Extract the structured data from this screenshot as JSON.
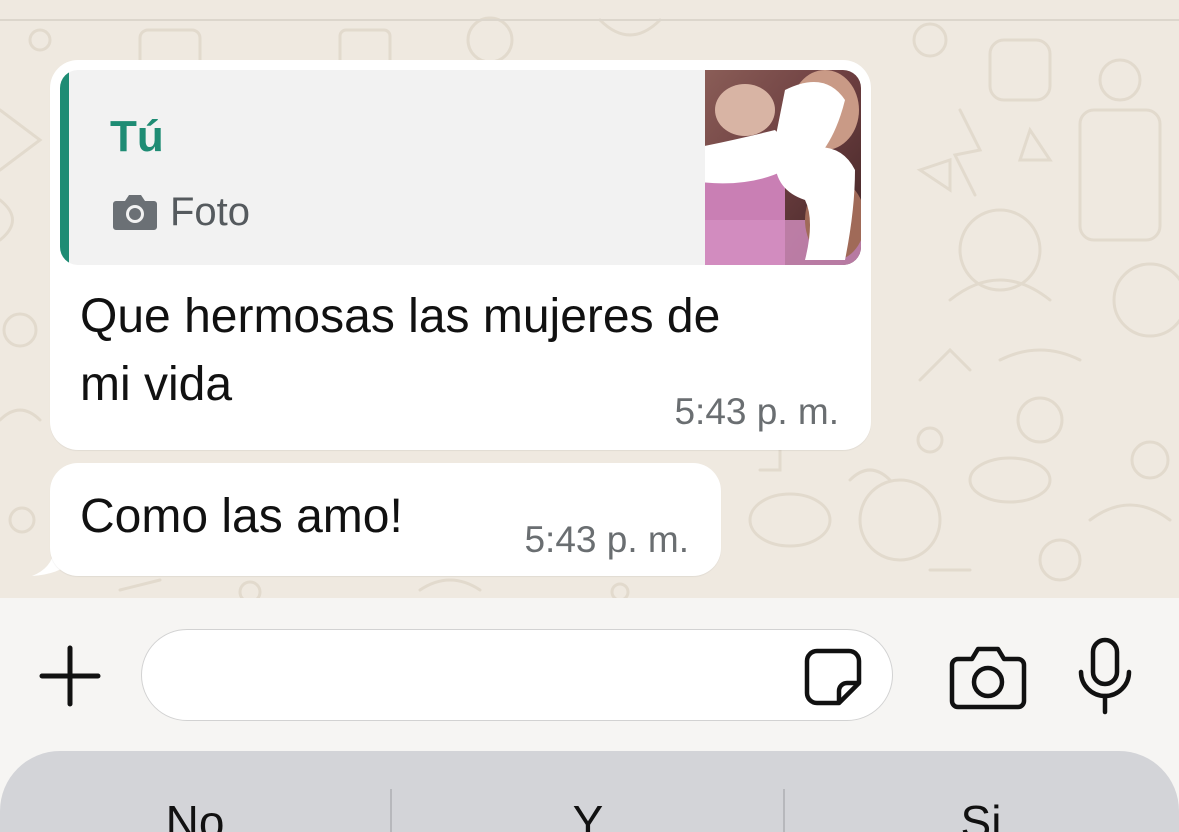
{
  "chat": {
    "messages": [
      {
        "reply_to": {
          "author": "Tú",
          "type_label": "Foto",
          "type_icon": "camera-icon"
        },
        "text": "Que hermosas las mujeres de\nmi vida",
        "time": "5:43 p. m."
      },
      {
        "text": "Como las amo!",
        "time": "5:43 p. m."
      }
    ]
  },
  "input_bar": {
    "message_value": "",
    "icons": [
      "plus-icon",
      "sticker-icon",
      "camera-icon",
      "microphone-icon"
    ]
  },
  "keyboard": {
    "suggestions": [
      "No",
      "Y",
      "Si"
    ]
  },
  "colors": {
    "accent": "#1e8c74",
    "wallpaper": "#efe9e0",
    "bubble": "#ffffff",
    "suggestion_bar": "#d3d4d8"
  }
}
